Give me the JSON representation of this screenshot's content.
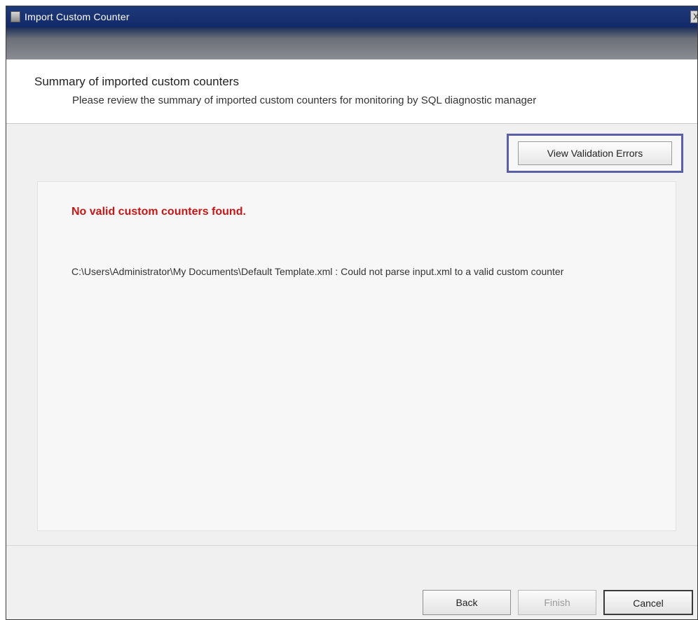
{
  "window": {
    "title": "Import Custom Counter",
    "close_glyph": "X"
  },
  "header": {
    "title": "Summary of imported custom counters",
    "subtitle": "Please review the summary of imported custom counters for monitoring by SQL diagnostic manager"
  },
  "content": {
    "view_errors_label": "View Validation Errors",
    "error_heading": "No valid custom counters found.",
    "error_detail": "C:\\Users\\Administrator\\My Documents\\Default Template.xml : Could not parse input.xml to a valid custom counter"
  },
  "footer": {
    "back_label": "Back",
    "finish_label": "Finish",
    "cancel_label": "Cancel"
  },
  "colors": {
    "titlebar": "#12296a",
    "error_text": "#c41818",
    "focus_border": "#5b5fa8"
  },
  "icons": {
    "window_icon": "application-icon",
    "close_icon": "close-icon"
  }
}
